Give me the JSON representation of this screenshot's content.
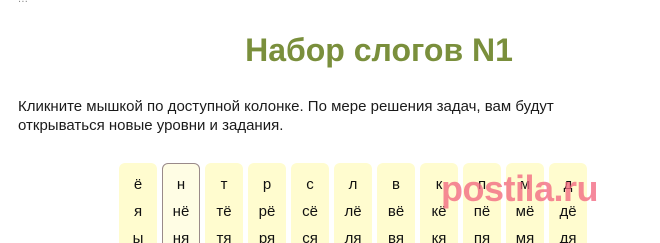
{
  "header": {
    "crumb": "... · · · · · · · · · · · · · · · · · · · · · · ·"
  },
  "title": "Набор слогов N1",
  "intro": {
    "line1": "Кликните мышкой по доступной колонке. По мере решения задач, вам будут",
    "line2": "открываться новые уровни и задания."
  },
  "columns": [
    {
      "syllables": [
        "ё",
        "я",
        "ы"
      ],
      "active": false
    },
    {
      "syllables": [
        "н",
        "нё",
        "ня"
      ],
      "active": true
    },
    {
      "syllables": [
        "т",
        "тё",
        "тя"
      ],
      "active": false
    },
    {
      "syllables": [
        "р",
        "рё",
        "ря"
      ],
      "active": false
    },
    {
      "syllables": [
        "с",
        "сё",
        "ся"
      ],
      "active": false
    },
    {
      "syllables": [
        "л",
        "лё",
        "ля"
      ],
      "active": false
    },
    {
      "syllables": [
        "в",
        "вё",
        "вя"
      ],
      "active": false
    },
    {
      "syllables": [
        "к",
        "кё",
        "кя"
      ],
      "active": false
    },
    {
      "syllables": [
        "п",
        "пё",
        "пя"
      ],
      "active": false
    },
    {
      "syllables": [
        "м",
        "мё",
        "мя"
      ],
      "active": false
    },
    {
      "syllables": [
        "д",
        "дё",
        "дя"
      ],
      "active": false
    }
  ],
  "watermark": "postila.ru"
}
